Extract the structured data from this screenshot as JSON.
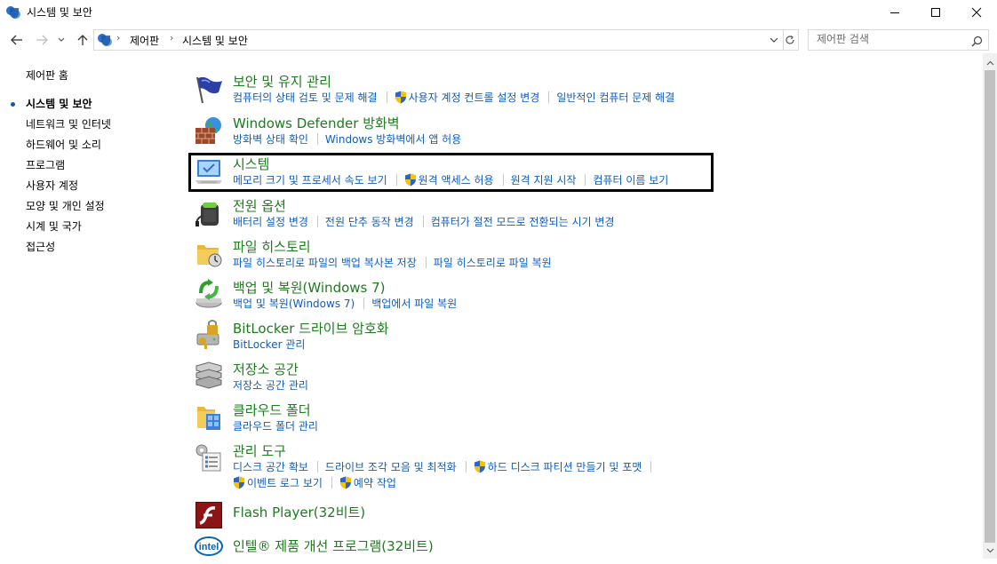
{
  "window": {
    "title": "시스템 및 보안"
  },
  "address": {
    "crumbs": [
      "제어판",
      "시스템 및 보안"
    ]
  },
  "search": {
    "placeholder": "제어판 검색"
  },
  "leftnav": {
    "items": [
      {
        "label": "제어판 홈"
      },
      {
        "label": "시스템 및 보안"
      },
      {
        "label": "네트워크 및 인터넷"
      },
      {
        "label": "하드웨어 및 소리"
      },
      {
        "label": "프로그램"
      },
      {
        "label": "사용자 계정"
      },
      {
        "label": "모양 및 개인 설정"
      },
      {
        "label": "시계 및 국가"
      },
      {
        "label": "접근성"
      }
    ]
  },
  "categories": [
    {
      "title": "보안 및 유지 관리",
      "icon": "flag-icon",
      "links": [
        "컴퓨터의 상태 검토 및 문제 해결",
        "사용자 계정 컨트롤 설정 변경",
        "일반적인 컴퓨터 문제 해결"
      ]
    },
    {
      "title": "Windows Defender 방화벽",
      "icon": "firewall-icon",
      "links": [
        "방화벽 상태 확인",
        "Windows 방화벽에서 앱 허용"
      ]
    },
    {
      "title": "시스템",
      "icon": "system-computer-icon",
      "links": [
        "메모리 크기 및 프로세서 속도 보기",
        "원격 액세스 허용",
        "원격 지원 시작",
        "컴퓨터 이름 보기"
      ]
    },
    {
      "title": "전원 옵션",
      "icon": "power-battery-icon",
      "links": [
        "배터리 설정 변경",
        "전원 단추 동작 변경",
        "컴퓨터가 절전 모드로 전환되는 시기 변경"
      ]
    },
    {
      "title": "파일 히스토리",
      "icon": "file-history-icon",
      "links": [
        "파일 히스토리로 파일의 백업 복사본 저장",
        "파일 히스토리로 파일 복원"
      ]
    },
    {
      "title": "백업 및 복원(Windows 7)",
      "icon": "backup-restore-icon",
      "links": [
        "백업 및 복원(Windows 7)",
        "백업에서 파일 복원"
      ]
    },
    {
      "title": "BitLocker 드라이브 암호화",
      "icon": "bitlocker-icon",
      "links": [
        "BitLocker 관리"
      ]
    },
    {
      "title": "저장소 공간",
      "icon": "storage-spaces-icon",
      "links": [
        "저장소 공간 관리"
      ]
    },
    {
      "title": "클라우드 폴더",
      "icon": "cloud-folder-icon",
      "links": [
        "클라우드 폴더 관리"
      ]
    },
    {
      "title": "관리 도구",
      "icon": "admin-tools-icon",
      "links": [
        "디스크 공간 확보",
        "드라이브 조각 모음 및 최적화",
        "하드 디스크 파티션 만들기 및 포맷",
        "이벤트 로그 보기",
        "예약 작업"
      ]
    },
    {
      "title": "Flash Player(32비트)",
      "icon": "flash-player-icon",
      "links": []
    },
    {
      "title": "인텔® 제품 개선 프로그램(32비트)",
      "icon": "intel-icon",
      "links": []
    }
  ],
  "colors": {
    "category_title": "#1e7b1e",
    "task_link": "#0f5dbf",
    "highlight_border": "#000000"
  }
}
